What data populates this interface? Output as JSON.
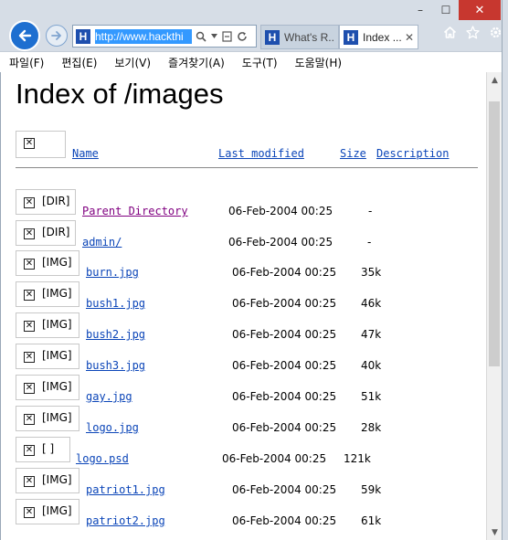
{
  "window": {
    "minimize": "–",
    "maximize": "☐",
    "close": "✕"
  },
  "nav": {
    "address": "http://www.hackthi",
    "tabs": [
      {
        "label": "What's R..."
      },
      {
        "label": "Index ...",
        "close": "✕"
      }
    ]
  },
  "menu": [
    "파일(F)",
    "편집(E)",
    "보기(V)",
    "즐겨찾기(A)",
    "도구(T)",
    "도움말(H)"
  ],
  "page": {
    "title": "Index of /images",
    "columns": {
      "name": "Name",
      "last_modified": "Last modified",
      "size": "Size",
      "description": "Description"
    },
    "rows": [
      {
        "alt": "[DIR]",
        "name": "Parent Directory",
        "date": "06-Feb-2004 00:25",
        "size": "-"
      },
      {
        "alt": "[DIR]",
        "name": "admin/",
        "date": "06-Feb-2004 00:25",
        "size": "-"
      },
      {
        "alt": "[IMG]",
        "name": "burn.jpg",
        "date": "06-Feb-2004 00:25",
        "size": "35k"
      },
      {
        "alt": "[IMG]",
        "name": "bush1.jpg",
        "date": "06-Feb-2004 00:25",
        "size": "46k"
      },
      {
        "alt": "[IMG]",
        "name": "bush2.jpg",
        "date": "06-Feb-2004 00:25",
        "size": "47k"
      },
      {
        "alt": "[IMG]",
        "name": "bush3.jpg",
        "date": "06-Feb-2004 00:25",
        "size": "40k"
      },
      {
        "alt": "[IMG]",
        "name": "gay.jpg",
        "date": "06-Feb-2004 00:25",
        "size": "51k"
      },
      {
        "alt": "[IMG]",
        "name": "logo.jpg",
        "date": "06-Feb-2004 00:25",
        "size": "28k"
      },
      {
        "alt": "[ ]",
        "name": "logo.psd",
        "date": "06-Feb-2004 00:25",
        "size": "121k"
      },
      {
        "alt": "[IMG]",
        "name": "patriot1.jpg",
        "date": "06-Feb-2004 00:25",
        "size": "59k"
      },
      {
        "alt": "[IMG]",
        "name": "patriot2.jpg",
        "date": "06-Feb-2004 00:25",
        "size": "61k"
      }
    ]
  },
  "colors": {
    "link": "#0b45b8",
    "visited": "#800080",
    "close_button": "#c7372f",
    "back_button": "#1e6fd0"
  },
  "icons": {
    "back": "back-arrow-icon",
    "forward": "forward-arrow-icon",
    "search": "search-icon",
    "compat": "compatibility-view-icon",
    "refresh": "refresh-icon",
    "home": "home-icon",
    "favorites": "star-icon",
    "tools": "gear-icon",
    "broken_image": "broken-image-icon"
  }
}
